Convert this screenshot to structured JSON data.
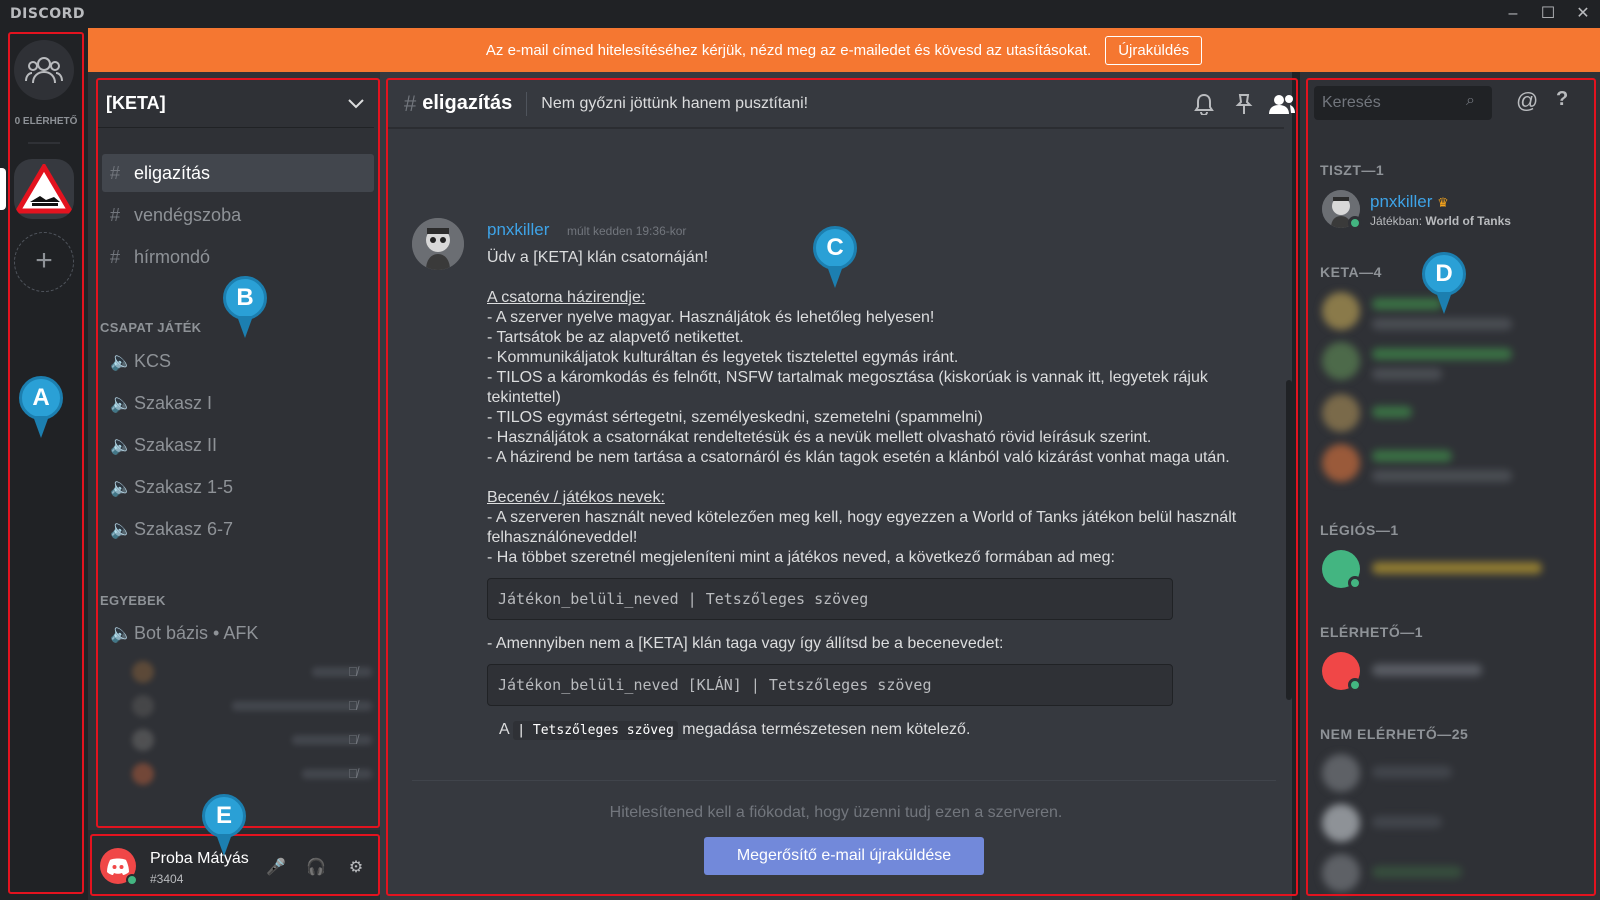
{
  "app": {
    "logo": "DISCORD",
    "window_controls": [
      "–",
      "☐",
      "✕"
    ]
  },
  "banner": {
    "text": "Az e-mail címed hitelesítéséhez kérjük, nézd meg az e-mailedet és kövesd az utasításokat.",
    "button": "Újraküldés",
    "color": "#f57731"
  },
  "rail": {
    "online_label": "0 ELÉRHETŐ",
    "add_server": "+"
  },
  "server": {
    "name": "[KETA]",
    "text_channels": [
      "eligazítás",
      "vendégszoba",
      "hírmondó"
    ],
    "active_channel": "eligazítás",
    "categories": [
      {
        "name": "CSAPAT JÁTÉK",
        "voice_channels": [
          "KCS",
          "Szakasz I",
          "Szakasz II",
          "Szakasz 1-5",
          "Szakasz 6-7"
        ]
      },
      {
        "name": "EGYEBEK",
        "voice_channels": [
          "Bot bázis • AFK"
        ]
      }
    ]
  },
  "user": {
    "name": "Proba Mátyás",
    "tag": "#3404"
  },
  "chat": {
    "channel": "eligazítás",
    "topic": "Nem győzni jöttünk hanem pusztítani!",
    "message": {
      "author": "pnxkiller",
      "time": "múlt kedden 19:36-kor",
      "greeting": "Üdv a [KETA] klán csatornáján!",
      "rules_heading": "A csatorna házirendje:",
      "rules": [
        " - A szerver nyelve magyar. Használjátok és lehetőleg helyesen!",
        " - Tartsátok be az alapvető netikettet.",
        " - Kommunikáljatok kulturáltan és legyetek tisztelettel egymás iránt.",
        " - TILOS a káromkodás és felnőtt, NSFW tartalmak megosztása (kiskorúak is vannak itt, legyetek rájuk tekintettel)",
        " - TILOS egymást sértegetni, személyeskedni, szemetelni (spammelni)",
        " - Használjátok a csatornákat rendeltetésük és a nevük mellett olvasható rövid leírásuk szerint.",
        " - A házirend be nem tartása a csatornáról és klán tagok esetén a klánból való kizárást vonhat maga után."
      ],
      "names_heading": "Becenév / játékos nevek:",
      "names_1": " - A szerveren használt neved kötelezően meg kell, hogy egyezzen a World of Tanks játékon belül használt felhasználóneveddel!",
      "names_2": " - Ha többet szeretnél megjeleníteni mint a játékos neved, a következő formában ad meg:",
      "code_1": "Játékon_belüli_neved | Tetszőleges szöveg",
      "names_3": " - Amennyiben nem a [KETA] klán taga vagy így állítsd be a becenevedet:",
      "code_2": "Játékon_belüli_neved [KLÁN] | Tetszőleges szöveg",
      "last_prefix": "A ",
      "last_code": "| Tetszőleges szöveg",
      "last_suffix": " megadása természetesen nem kötelező."
    },
    "verify_text": "Hitelesítened kell a fiókodat, hogy üzenni tudj ezen a szerveren.",
    "verify_button": "Megerősítő e-mail újraküldése"
  },
  "members": {
    "search_placeholder": "Keresés",
    "groups": [
      {
        "label": "TISZT—1"
      },
      {
        "label": "KETA—4"
      },
      {
        "label": "LÉGIÓS—1"
      },
      {
        "label": "ELÉRHETŐ—1"
      },
      {
        "label": "NEM ELÉRHETŐ—25"
      }
    ],
    "tiszt_member": {
      "name": "pnxkiller",
      "activity_prefix": "Játékban: ",
      "activity_game": "World of Tanks"
    }
  },
  "annotations": {
    "labels": [
      "A",
      "B",
      "C",
      "D",
      "E"
    ],
    "border_color": "#e3131f",
    "pin_color": "#2aa0d6"
  }
}
